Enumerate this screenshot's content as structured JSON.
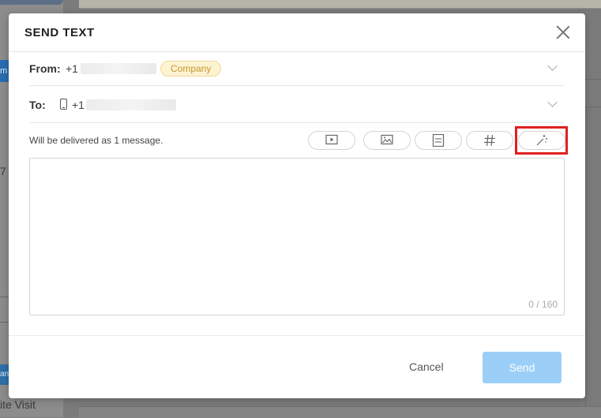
{
  "background": {
    "left_badge_text": "m",
    "left_partial_text": "7",
    "bottom_badge_text": "an",
    "bottom_text": "ite Visit"
  },
  "modal": {
    "title": "SEND TEXT",
    "from": {
      "label": "From:",
      "number_prefix": "+1",
      "badge": "Company"
    },
    "to": {
      "label": "To:",
      "number_prefix": "+1"
    },
    "delivery_note": "Will be delivered as 1 message.",
    "toolbar_icons": [
      "video-icon",
      "image-icon",
      "document-icon",
      "hashtag-icon",
      "magic-wand-icon"
    ],
    "message": {
      "value": "",
      "counter": "0 / 160"
    },
    "cancel_label": "Cancel",
    "send_label": "Send"
  },
  "colors": {
    "send_button_disabled": "#9ccff7",
    "badge_bg": "#fdf3d3",
    "badge_text": "#c9972b",
    "highlight": "#e02020"
  }
}
